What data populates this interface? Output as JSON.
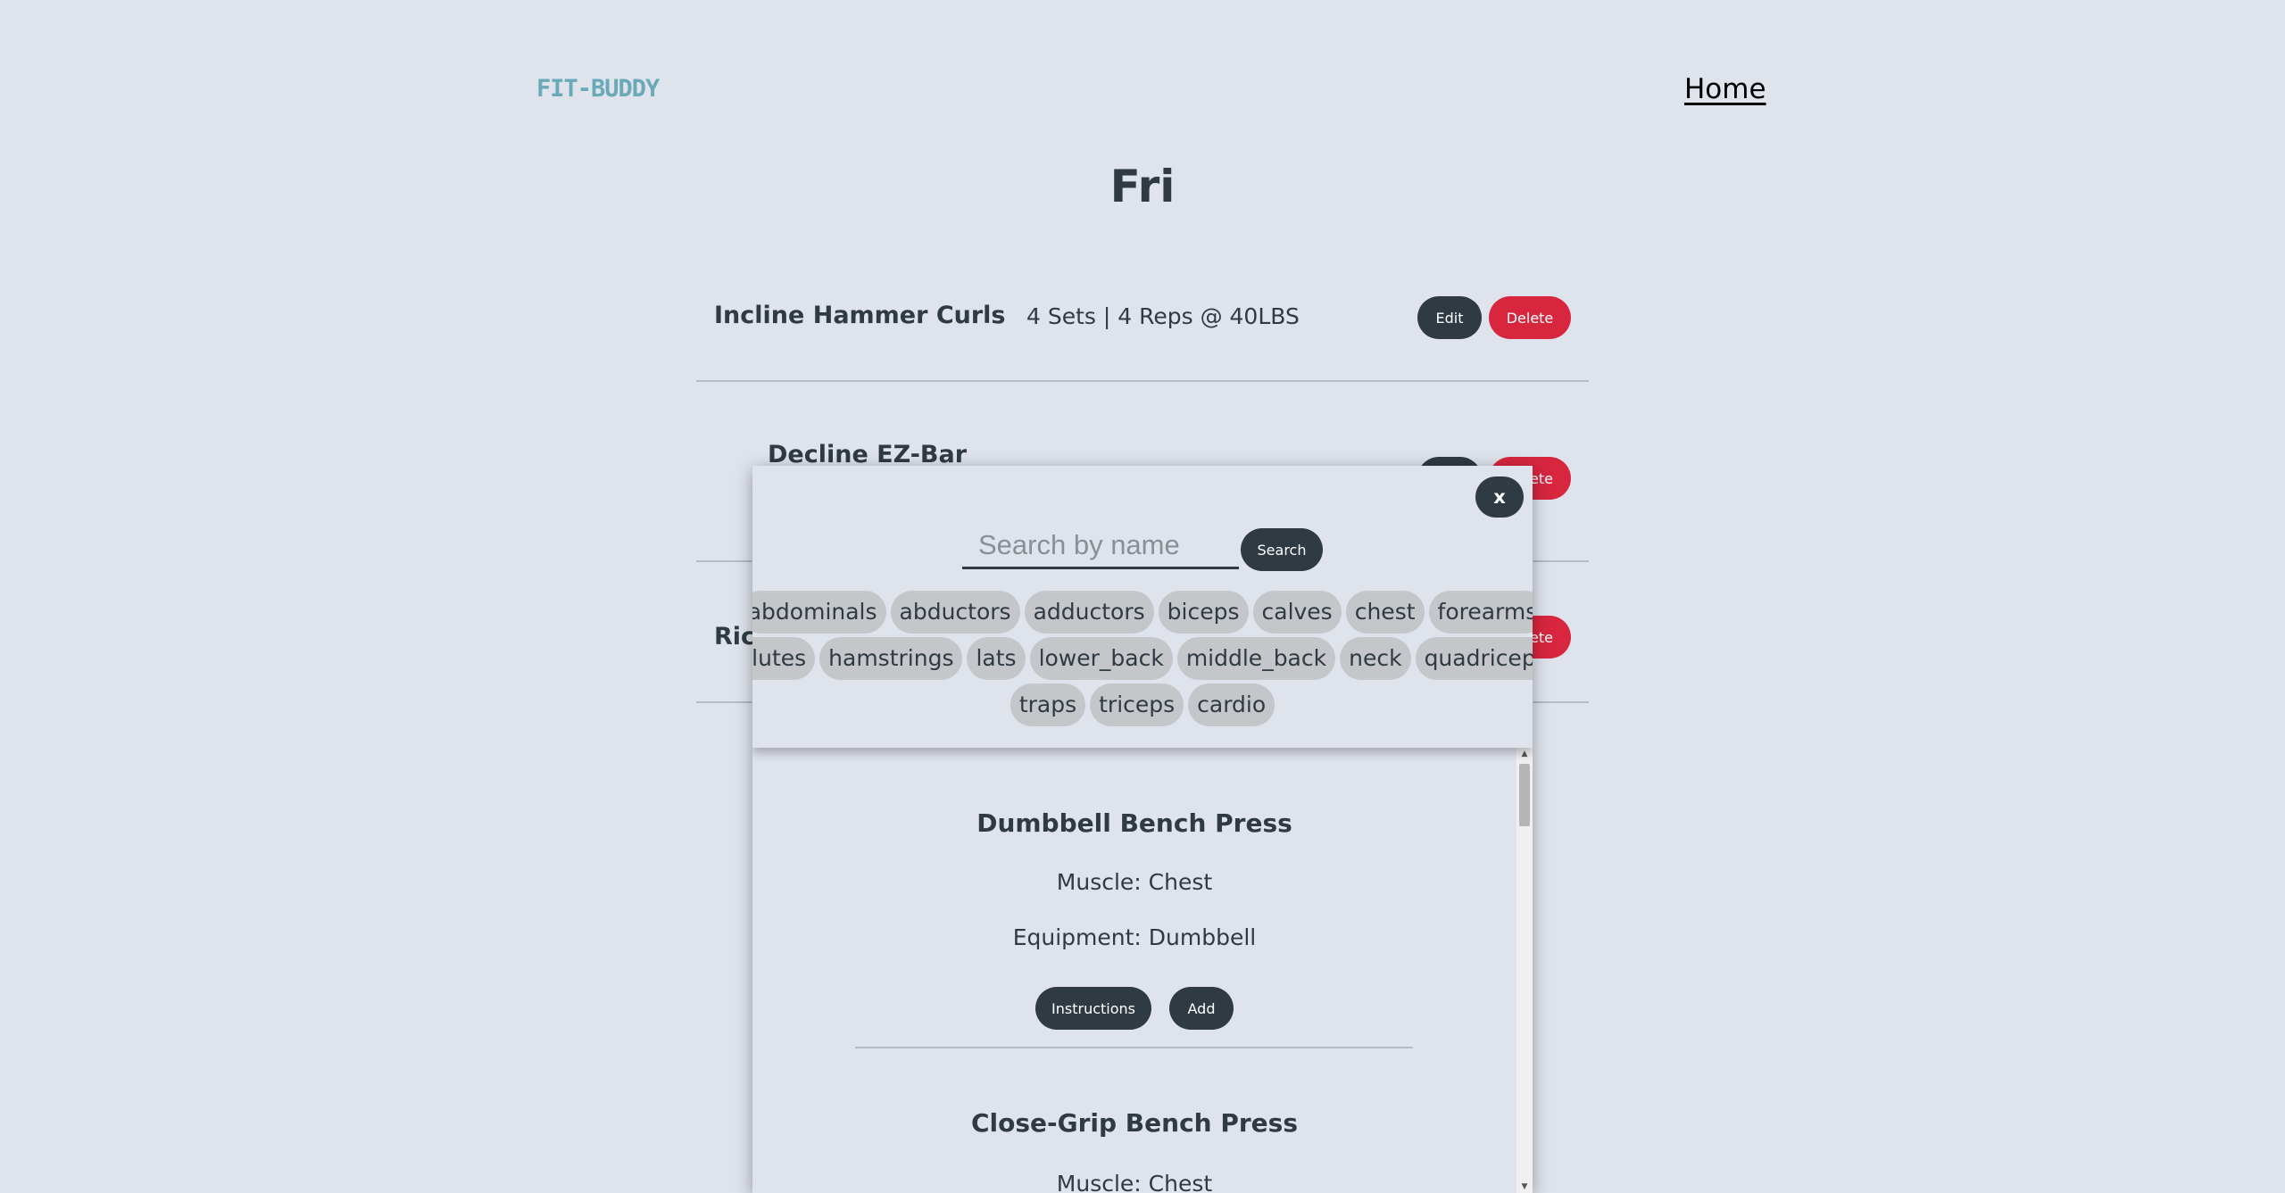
{
  "header": {
    "logo": "FIT-BUDDY",
    "nav_home": "Home"
  },
  "page": {
    "title": "Fri"
  },
  "exercises": [
    {
      "name": "Incline Hammer Curls",
      "detail": "4 Sets | 4 Reps @ 40LBS",
      "edit": "Edit",
      "delete": "Delete"
    },
    {
      "name": "Decline EZ-Bar",
      "delete_partial": "ete"
    },
    {
      "name_partial": "Ric",
      "delete_partial": "ete"
    }
  ],
  "modal": {
    "close_label": "x",
    "search": {
      "placeholder": "Search by name",
      "button": "Search"
    },
    "muscle_tags": [
      [
        "abdominals",
        "abductors",
        "adductors",
        "biceps",
        "calves",
        "chest",
        "forearms"
      ],
      [
        "glutes",
        "hamstrings",
        "lats",
        "lower_back",
        "middle_back",
        "neck",
        "quadriceps"
      ],
      [
        "traps",
        "triceps",
        "cardio"
      ]
    ],
    "results": [
      {
        "name": "Dumbbell Bench Press",
        "muscle": "Muscle: Chest",
        "equipment": "Equipment: Dumbbell",
        "instructions": "Instructions",
        "add": "Add"
      },
      {
        "name": "Close-Grip Bench Press",
        "muscle": "Muscle: Chest"
      }
    ],
    "scroll_up_icon": "triangle-up",
    "scroll_down_icon": "triangle-down"
  }
}
